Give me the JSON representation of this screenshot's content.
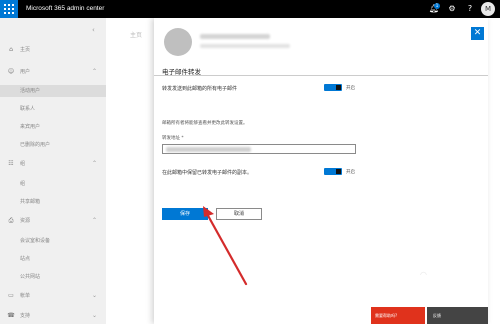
{
  "app": {
    "title": "Microsoft 365 admin center",
    "notification_count": "1",
    "user_initial": "M"
  },
  "sidebar": {
    "items": [
      {
        "label": "主页",
        "icon": "home-icon",
        "type": "top"
      },
      {
        "label": "用户",
        "icon": "person-icon",
        "type": "top",
        "expanded": true
      },
      {
        "label": "活动用户",
        "type": "sub",
        "active": true
      },
      {
        "label": "联系人",
        "type": "sub"
      },
      {
        "label": "来宾用户",
        "type": "sub"
      },
      {
        "label": "已删除的用户",
        "type": "sub"
      },
      {
        "label": "组",
        "icon": "group-icon",
        "type": "top",
        "expanded": true
      },
      {
        "label": "组",
        "type": "sub"
      },
      {
        "label": "共享邮箱",
        "type": "sub"
      },
      {
        "label": "资源",
        "icon": "printer-icon",
        "type": "top",
        "expanded": true
      },
      {
        "label": "会议室和设备",
        "type": "sub"
      },
      {
        "label": "站点",
        "type": "sub"
      },
      {
        "label": "公共网站",
        "type": "sub"
      },
      {
        "label": "帐单",
        "icon": "billing-icon",
        "type": "top"
      },
      {
        "label": "支持",
        "icon": "headset-icon",
        "type": "top"
      }
    ]
  },
  "main": {
    "breadcrumb": "主页"
  },
  "panel": {
    "section_title": "电子邮件转发",
    "forward_all_label": "转发发送到此邮箱的所有电子邮件",
    "toggle_on_label": "开启",
    "note": "邮箱所有者将能够查看并更改此转发设置。",
    "address_label": "转发地址 *",
    "keep_copy_label": "在此邮箱中保留已转发电子邮件的副本。",
    "save_label": "保存",
    "cancel_label": "取消"
  },
  "bottom": {
    "help_label": "需要帮助吗?",
    "feedback_label": "反馈"
  },
  "colors": {
    "accent": "#0078d4",
    "topbar": "#000000",
    "sidebar": "#f0f0f0",
    "annotation_arrow": "#d42b2b"
  }
}
